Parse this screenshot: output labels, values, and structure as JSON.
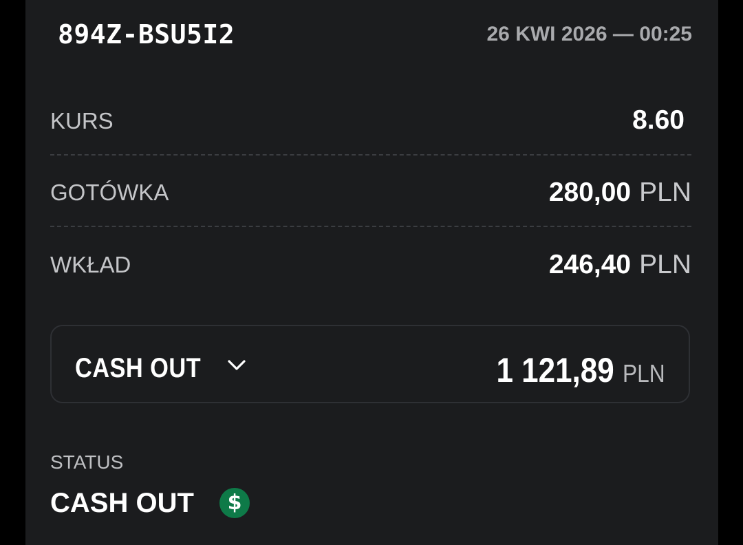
{
  "bet": {
    "id": "894Z-BSU5I2",
    "date": "26 KWI 2026 — 00:25"
  },
  "rows": {
    "kurs": {
      "label": "KURS",
      "value": "8.60"
    },
    "gotowka": {
      "label": "GOTÓWKA",
      "value": "280,00",
      "currency": "PLN"
    },
    "wklad": {
      "label": "WKŁAD",
      "value": "246,40",
      "currency": "PLN"
    }
  },
  "cashout": {
    "label": "CASH OUT",
    "amount": "1 121,89",
    "currency": "PLN",
    "icon": "chevron-down-icon"
  },
  "status": {
    "label": "STATUS",
    "value": "CASH OUT",
    "icon": "dollar-icon",
    "icon_glyph": "$",
    "icon_color": "#0e7a48"
  }
}
